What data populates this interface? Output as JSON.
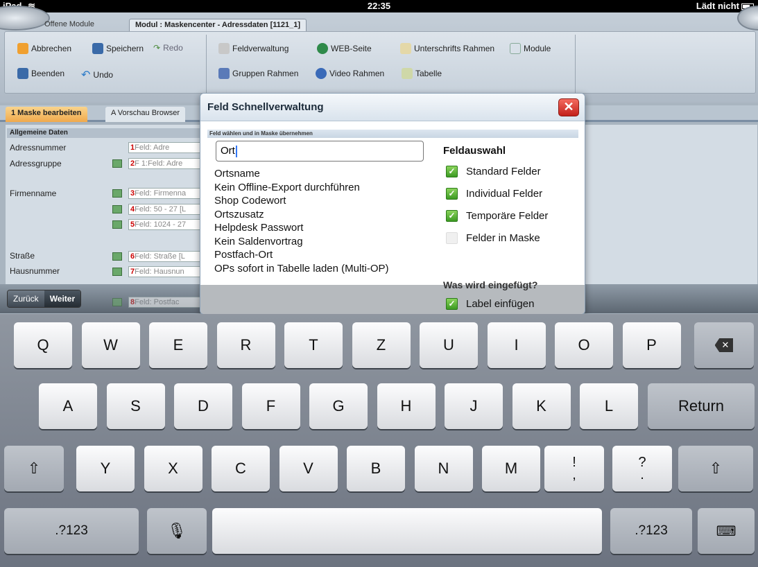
{
  "status_bar": {
    "device": "iPad",
    "time": "22:35",
    "battery_text": "Lädt nicht"
  },
  "app": {
    "tab_open_modules": "Offene Module",
    "tab_active_module": "Modul : Maskencenter - Adressdaten [1121_1]",
    "ribbon": {
      "cancel": "Abbrechen",
      "save": "Speichern",
      "redo": "Redo",
      "quit": "Beenden",
      "undo": "Undo",
      "field_mgmt": "Feldverwaltung",
      "web_page": "WEB-Seite",
      "signature_frame": "Unterschrifts Rahmen",
      "modules": "Module",
      "group_frame": "Gruppen Rahmen",
      "video_frame": "Video Rahmen",
      "table": "Tabelle"
    },
    "sub_tabs": {
      "edit_mask": "1 Maske bearbeiten",
      "preview": "A Vorschau Browser"
    },
    "form": {
      "group_title": "Allgemeine Daten",
      "labels": {
        "adressnummer": "Adressnummer",
        "adressgruppe": "Adressgruppe",
        "firmenname": "Firmenname",
        "strasse": "Straße",
        "hausnummer": "Hausnummer"
      },
      "fields": [
        {
          "num": "1",
          "text": "Feld: Adre"
        },
        {
          "num": "2",
          "text": "F  1:Feld: Adre"
        },
        {
          "num": "3",
          "text": "Feld: Firmenna"
        },
        {
          "num": "4",
          "text": "Feld: 50 - 27 [L"
        },
        {
          "num": "5",
          "text": "Feld: 1024 - 27"
        },
        {
          "num": "6",
          "text": "Feld: Straße  [L"
        },
        {
          "num": "7",
          "text": "Feld: Hausnun"
        },
        {
          "num": "8",
          "text": "Feld: Postfac"
        }
      ]
    },
    "nav": {
      "back": "Zurück",
      "next": "Weiter"
    }
  },
  "dialog": {
    "title": "Feld Schnellverwaltung",
    "close_icon": "close-icon",
    "section_title": "Feld wählen und in Maske übernehmen",
    "search_value": "Ort",
    "results": [
      "Ortsname",
      "Kein Offline-Export durchführen",
      "Shop Codewort",
      "Ortszusatz",
      "Helpdesk Passwort",
      "Kein Saldenvortrag",
      "Postfach-Ort",
      "OPs sofort in Tabelle laden (Multi-OP)"
    ],
    "feldauswahl_title": "Feldauswahl",
    "options": [
      {
        "label": "Standard Felder",
        "checked": true
      },
      {
        "label": "Individual Felder",
        "checked": true
      },
      {
        "label": "Temporäre Felder",
        "checked": true
      },
      {
        "label": "Felder in Maske",
        "checked": false
      }
    ],
    "insert_title": "Was wird eingefügt?",
    "insert_option": {
      "label": "Label einfügen",
      "checked": true
    }
  },
  "keyboard": {
    "row1": [
      "Q",
      "W",
      "E",
      "R",
      "T",
      "Z",
      "U",
      "I",
      "O",
      "P"
    ],
    "row2": [
      "A",
      "S",
      "D",
      "F",
      "G",
      "H",
      "J",
      "K",
      "L"
    ],
    "row3": [
      "Y",
      "X",
      "C",
      "V",
      "B",
      "N",
      "M"
    ],
    "return": "Return",
    "punct1": "!\n,",
    "punct2": "?\n.",
    "numbers": ".?123",
    "mic_icon": "microphone-icon",
    "hide_icon": "keyboard-hide-icon",
    "backspace_icon": "backspace-icon",
    "shift_icon": "shift-icon",
    "checkbox_mark": "✓"
  }
}
